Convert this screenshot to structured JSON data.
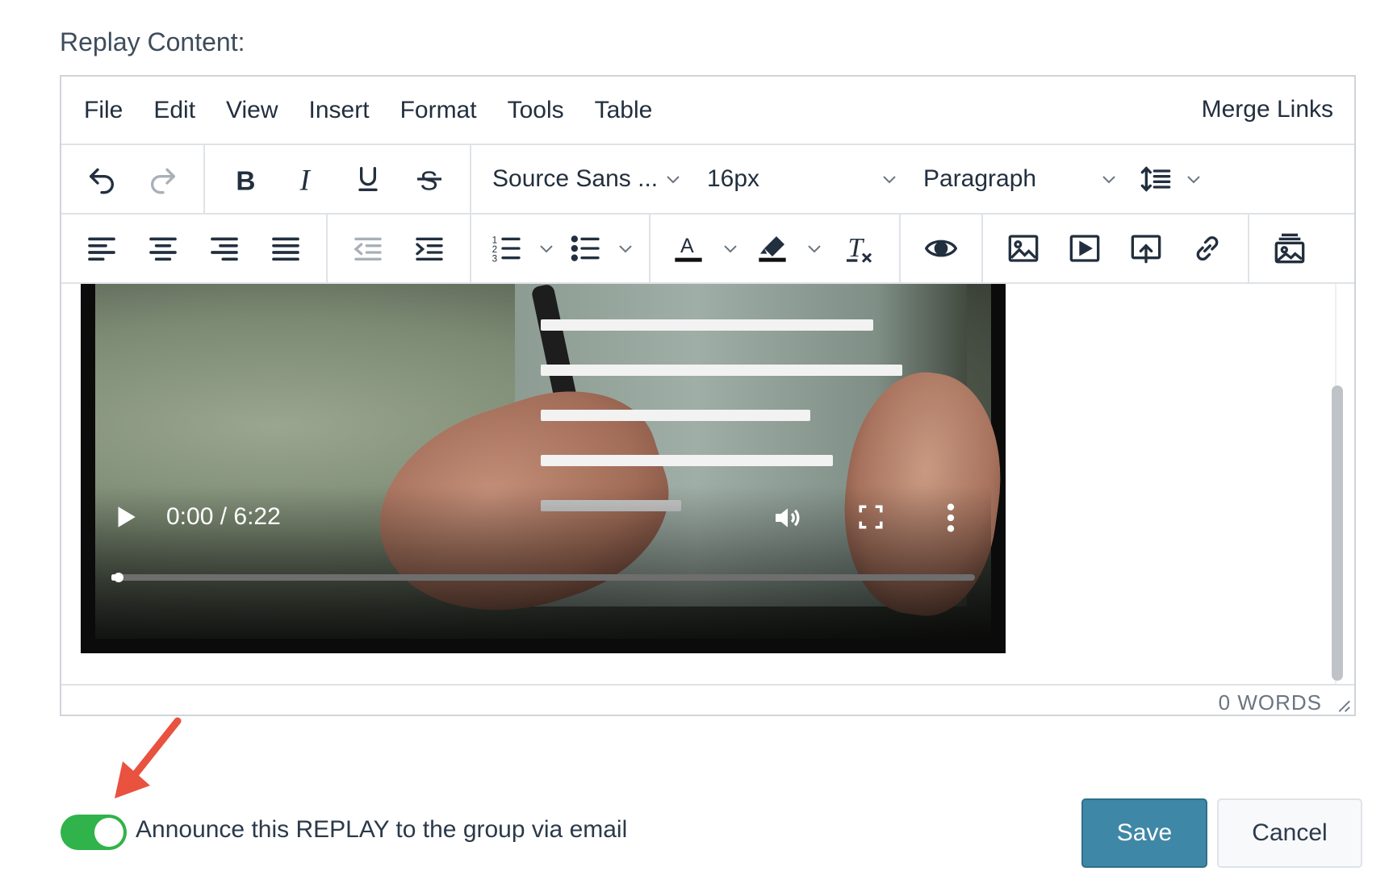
{
  "section_label": "Replay Content:",
  "menubar": {
    "items": [
      "File",
      "Edit",
      "View",
      "Insert",
      "Format",
      "Tools",
      "Table"
    ],
    "merge_links": "Merge Links"
  },
  "toolbar": {
    "font_family": "Source Sans ...",
    "font_size": "16px",
    "block_format": "Paragraph"
  },
  "video": {
    "time": "0:00 / 6:22",
    "progress": 0.005
  },
  "statusbar": {
    "word_count": "0 WORDS"
  },
  "announce": {
    "label": "Announce this REPLAY to the group via email",
    "enabled": true
  },
  "actions": {
    "save": "Save",
    "cancel": "Cancel"
  },
  "colors": {
    "toggle_on": "#2fb34a",
    "save_bg": "#3f87a6",
    "arrow": "#e8523f"
  }
}
